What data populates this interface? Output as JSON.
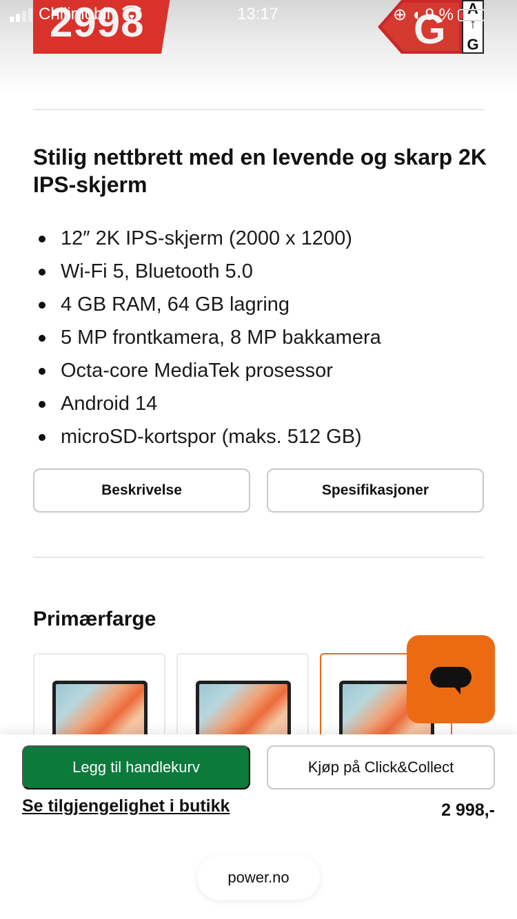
{
  "status_bar": {
    "carrier": "Chilimobil",
    "time": "13:17",
    "battery": "9 %",
    "battery_level_percent": 9
  },
  "product": {
    "price_badge": "2998",
    "energy_class": {
      "letter": "G",
      "scale_top": "A",
      "scale_bottom": "G"
    },
    "headline": "Stilig nettbrett med en levende og skarp 2K IPS-skjerm",
    "features": [
      "12″ 2K IPS-skjerm (2000 x 1200)",
      "Wi-Fi 5, Bluetooth 5.0",
      "4 GB RAM, 64 GB lagring",
      "5 MP frontkamera, 8 MP bakkamera",
      "Octa-core MediaTek prosessor",
      "Android 14",
      "microSD-kortspor (maks. 512 GB)"
    ]
  },
  "tabs": {
    "description": "Beskrivelse",
    "specifications": "Spesifikasjoner"
  },
  "color_section": {
    "title": "Primærfarge",
    "selected_index": 2
  },
  "purchase_bar": {
    "add_to_cart": "Legg til handlekurv",
    "click_collect": "Kjøp på Click&Collect",
    "availability_link": "Se tilgjengelighet i butikk",
    "price": "2 998,-"
  },
  "browser": {
    "url": "power.no"
  },
  "colors": {
    "brand_orange": "#ec6b12",
    "cta_green": "#0b7a3b",
    "price_red": "#d9322a"
  }
}
